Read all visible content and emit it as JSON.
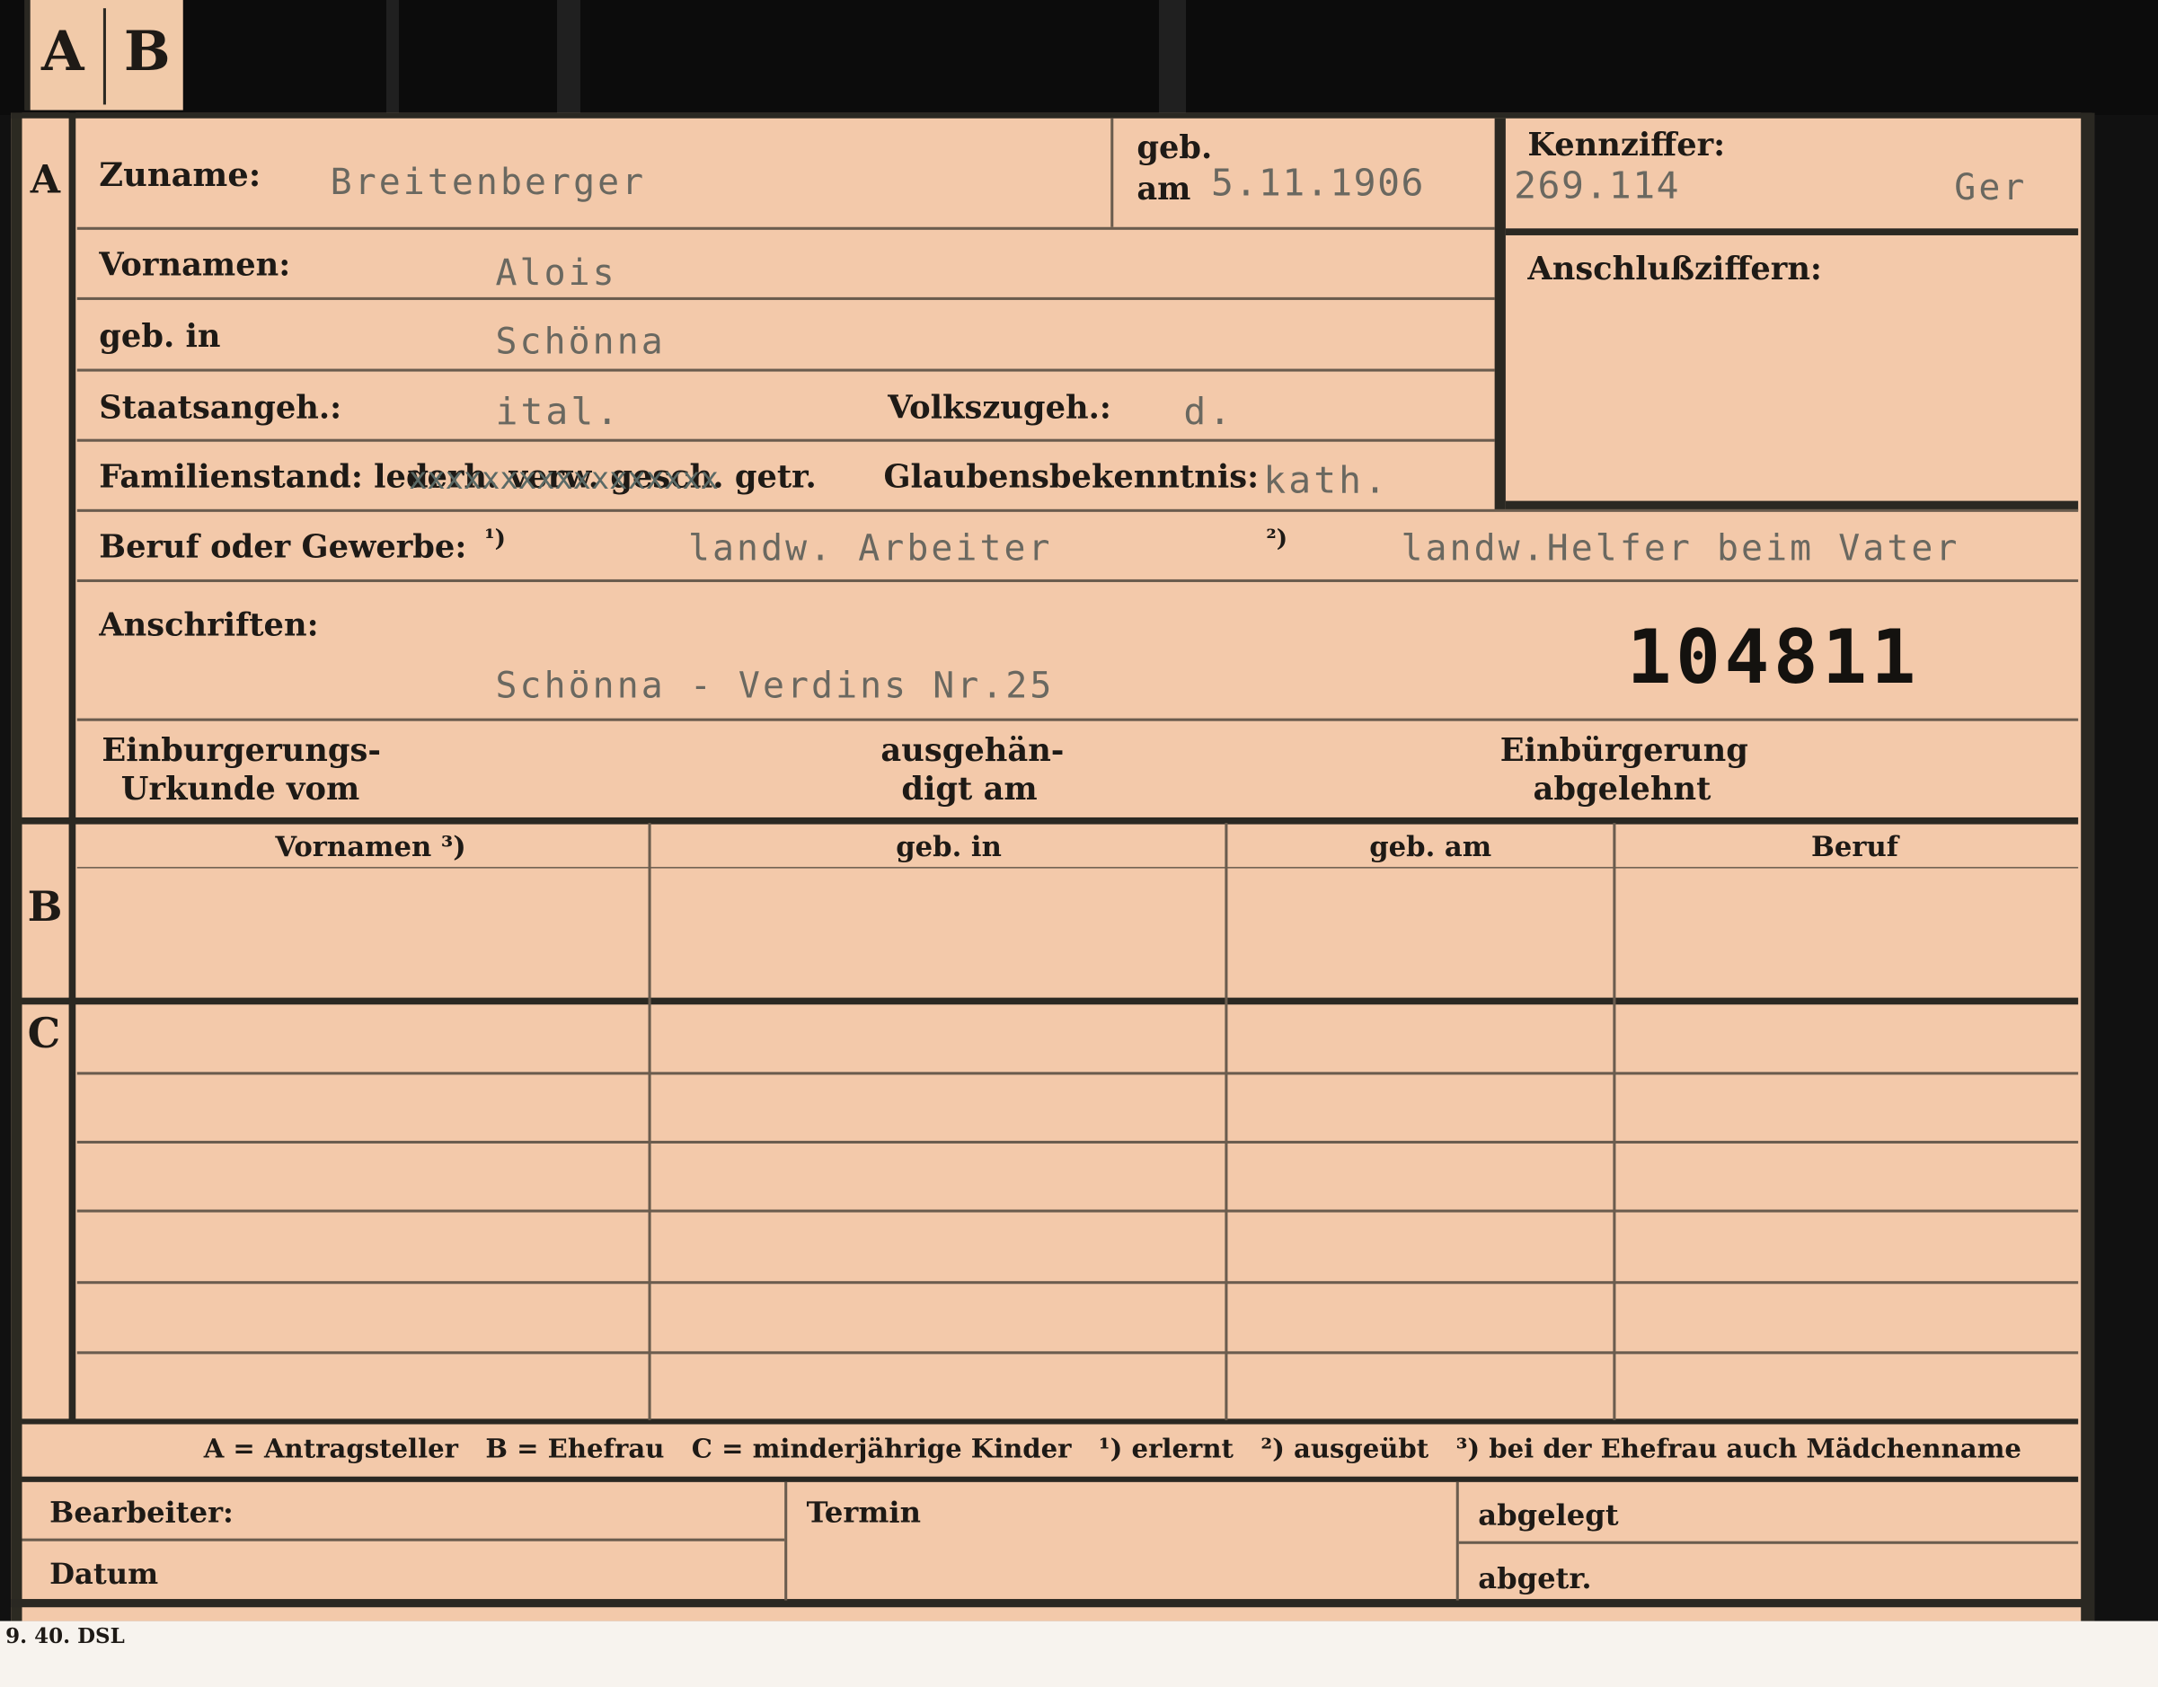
{
  "tab": {
    "letter_a": "A",
    "letter_b": "B"
  },
  "section_letters": {
    "a": "A",
    "b": "B",
    "c": "C"
  },
  "labels": {
    "zuname": "Zuname:",
    "geb": "geb.",
    "am": "am",
    "kennziffer": "Kennziffer:",
    "vornamen": "Vornamen:",
    "geb_in": "geb. in",
    "anschlussziffern": "Anschlußziffern:",
    "staatsangeh": "Staatsangeh.:",
    "volkszugeh": "Volkszugeh.:",
    "familienstand": "Familienstand: led.",
    "familienstand_crossed": "verh. verw. gesch. getr.",
    "glaubensbekenntnis": "Glaubensbekenntnis:",
    "beruf_oder_gewerbe": "Beruf oder Gewerbe:",
    "beruf_note_1": "¹)",
    "beruf_note_2": "²)",
    "anschriften": "Anschriften:",
    "einburgerung_line1": "Einburgerungs-",
    "einburgerung_line2": "Urkunde vom",
    "ausgehandigt_line1": "ausgehän-",
    "ausgehandigt_line2": "digt am",
    "abgelehnt_line1": "Einbürgerung",
    "abgelehnt_line2": "abgelehnt"
  },
  "values": {
    "zuname": "Breitenberger",
    "geb_am": "5.11.1906",
    "kennziffer": "269.114",
    "kennziffer_suffix": "Ger",
    "vornamen": "Alois",
    "geb_in": "Schönna",
    "staatsangeh": "ital.",
    "volkszugeh": "d.",
    "familienstand_typed": "xxxxxxxxxxxxxxxxx",
    "glaubensbekenntnis": "kath.",
    "beruf_erlernt": "landw. Arbeiter",
    "beruf_ausgeuebt": "landw.Helfer beim Vater",
    "anschrift": "Schönna - Verdins Nr.25",
    "stamp_number": "104811"
  },
  "table": {
    "headers": [
      "Vornamen ³)",
      "geb. in",
      "geb. am",
      "Beruf"
    ],
    "rows": []
  },
  "footer": {
    "legend": "A = Antragsteller   B = Ehefrau   C = minderjährige Kinder   ¹) erlernt   ²) ausgeübt   ³) bei der Ehefrau auch Mädchenname",
    "bearbeiter": "Bearbeiter:",
    "termin": "Termin",
    "abgelegt": "abgelegt",
    "datum": "Datum",
    "abgetr": "abgetr.",
    "print_mark": "9. 40. DSL"
  }
}
